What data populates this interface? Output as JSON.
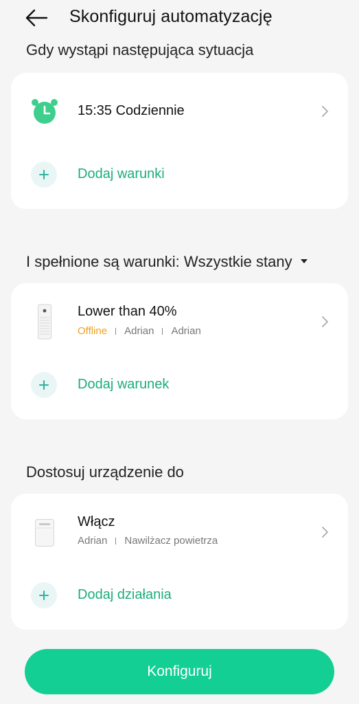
{
  "header": {
    "title": "Skonfiguruj automatyzację"
  },
  "trigger_section": {
    "title": "Gdy wystąpi następująca sytuacja",
    "item": {
      "icon": "alarm-clock-icon",
      "label": "15:35 Codziennie"
    },
    "add_label": "Dodaj warunki"
  },
  "condition_section": {
    "title": "I spełnione są warunki: Wszystkie stany",
    "item": {
      "icon": "air-purifier-icon",
      "label": "Lower than 40%",
      "status": "Offline",
      "room": "Adrian",
      "home": "Adrian"
    },
    "add_label": "Dodaj warunek"
  },
  "action_section": {
    "title": "Dostosuj urządzenie do",
    "item": {
      "icon": "humidifier-icon",
      "label": "Włącz",
      "room": "Adrian",
      "device": "Nawilżacz powietrza"
    },
    "add_label": "Dodaj działania"
  },
  "footer": {
    "configure_label": "Konfiguruj"
  },
  "colors": {
    "accent": "#13cf93",
    "accent_text": "#1dac7c",
    "offline": "#f0a020",
    "clock_green": "#3ecf8e"
  }
}
